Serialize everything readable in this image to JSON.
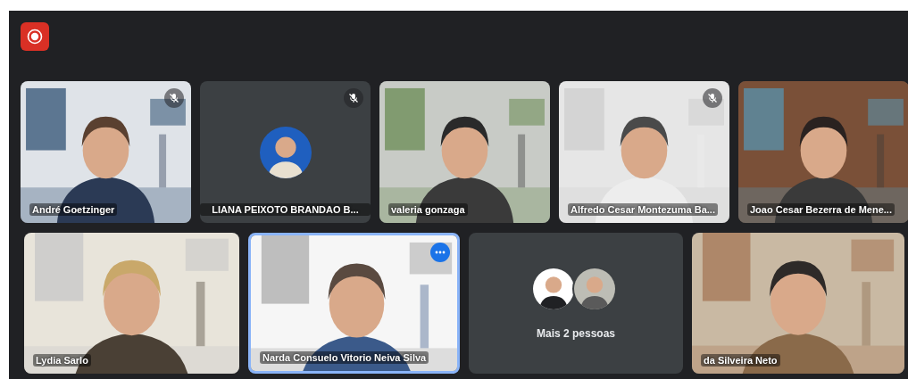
{
  "recording": true,
  "rows": [
    {
      "tiles": [
        {
          "kind": "video",
          "name": "André Goetzinger",
          "muted": true,
          "selected": false
        },
        {
          "name": "LIANA PEIXOTO BRANDAO B...",
          "muted": true,
          "selected": false
        },
        {
          "kind": "video",
          "name": "valeria gonzaga",
          "muted": false,
          "selected": false
        },
        {
          "kind": "video",
          "name": "Alfredo Cesar Montezuma Ba...",
          "muted": true,
          "selected": false
        },
        {
          "kind": "video",
          "name": "Joao Cesar Bezerra de Mene...",
          "muted": false,
          "selected": false
        }
      ]
    },
    {
      "tiles": [
        {
          "kind": "video",
          "name": "Lydia Sarlo",
          "muted": false,
          "selected": false
        },
        {
          "kind": "video",
          "name": "Narda Consuelo Vitorio Neiva Silva",
          "muted": false,
          "selected": true
        },
        {
          "kind": "more",
          "name": "Mais 2 pessoas",
          "avatars": [
            {
              "kind": "person"
            },
            {
              "kind": "person"
            }
          ],
          "muted": false,
          "selected": false
        },
        {
          "kind": "video",
          "name": "da Silveira Neto",
          "muted": false,
          "selected": false
        }
      ]
    }
  ]
}
